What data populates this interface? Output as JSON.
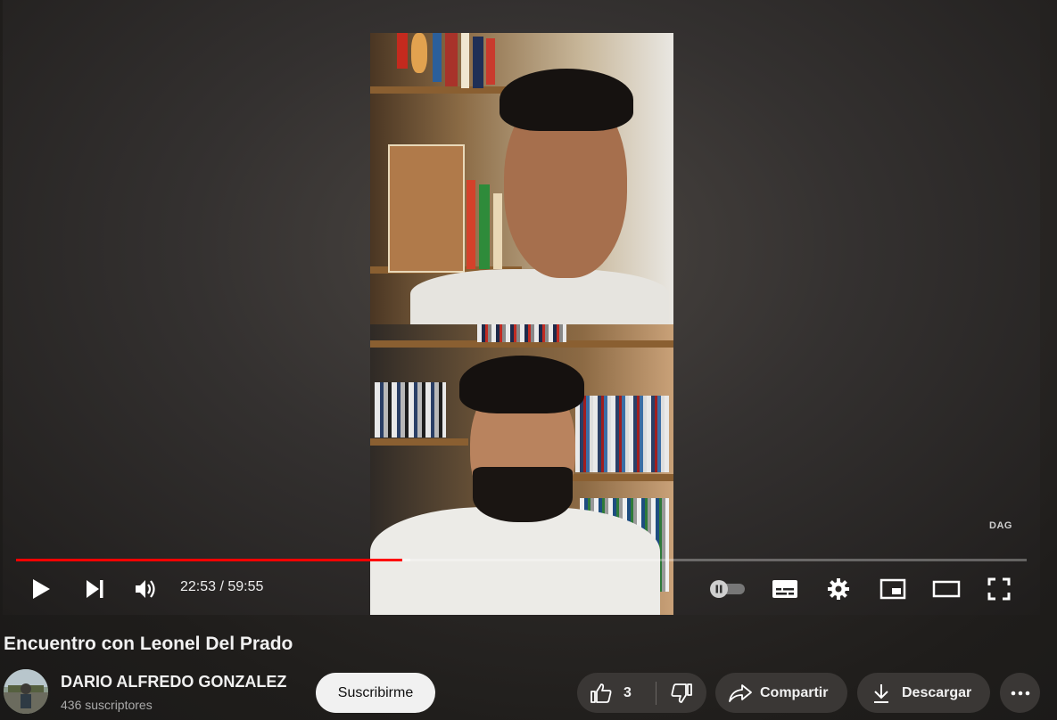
{
  "video": {
    "watermark": "DAG",
    "current_time": "22:53",
    "duration": "59:55",
    "time_display": "22:53 / 59:55",
    "progress": 0.382,
    "buffered": 0.39
  },
  "controls": {
    "play_icon": "play-icon",
    "next_icon": "next-icon",
    "volume_icon": "volume-icon",
    "autoplay_icon": "autoplay-toggle-icon",
    "captions_icon": "captions-icon",
    "settings_icon": "gear-icon",
    "miniplayer_icon": "miniplayer-icon",
    "theater_icon": "theater-icon",
    "fullscreen_icon": "fullscreen-icon"
  },
  "meta": {
    "title": "Encuentro con Leonel Del Prado",
    "channel_name": "DARIO ALFREDO GONZALEZ",
    "subscribers": "436 suscriptores",
    "subscribe_label": "Suscribirme",
    "like_count": "3",
    "share_label": "Compartir",
    "download_label": "Descargar"
  },
  "colors": {
    "accent": "#ff0000",
    "pill_bg": "#3a3735",
    "subscribe_bg": "#f1f1f1"
  }
}
